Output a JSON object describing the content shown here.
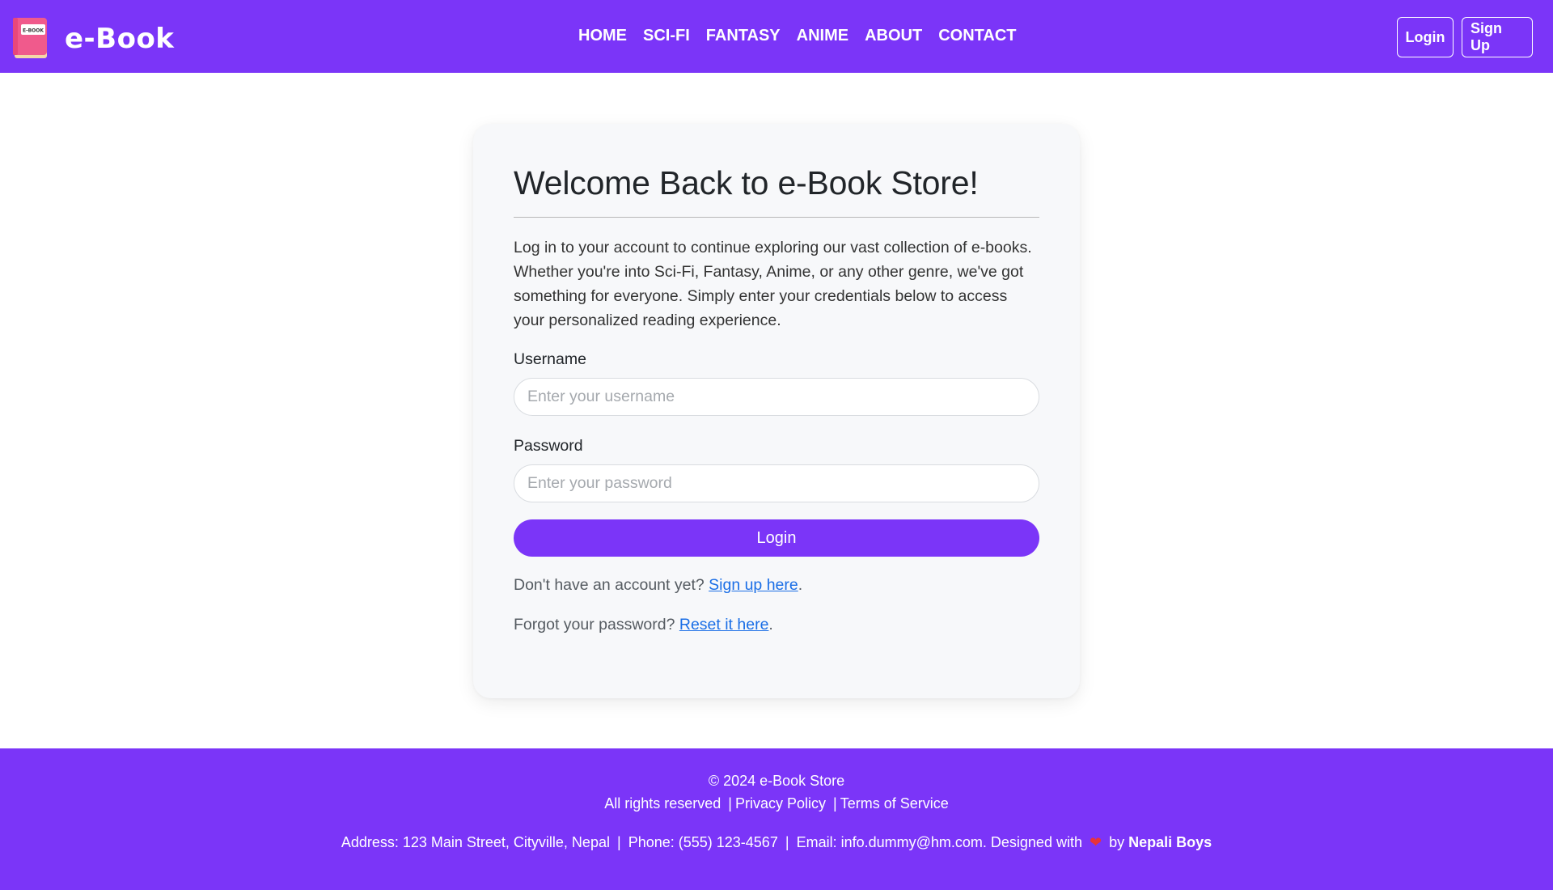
{
  "brand": {
    "name": "e-Book",
    "logo_text": "E-BOOK"
  },
  "nav": {
    "links": [
      "HOME",
      "SCI-FI",
      "FANTASY",
      "ANIME",
      "ABOUT",
      "CONTACT"
    ],
    "login_label": "Login",
    "signup_label": "Sign Up"
  },
  "card": {
    "title": "Welcome Back to e-Book Store!",
    "intro": "Log in to your account to continue exploring our vast collection of e-books. Whether you're into Sci-Fi, Fantasy, Anime, or any other genre, we've got something for everyone. Simply enter your credentials below to access your personalized reading experience.",
    "username_label": "Username",
    "username_placeholder": "Enter your username",
    "password_label": "Password",
    "password_placeholder": "Enter your password",
    "login_button": "Login",
    "signup_prompt": "Don't have an account yet?",
    "signup_link": "Sign up here",
    "reset_prompt": "Forgot your password?",
    "reset_link": "Reset it here",
    "period": "."
  },
  "footer": {
    "copyright": "© 2024 e-Book Store",
    "rights": "All rights reserved",
    "separator": "|",
    "privacy": "Privacy Policy",
    "terms": "Terms of Service",
    "address": "Address: 123 Main Street, Cityville, Nepal",
    "phone": "Phone: (555) 123-4567",
    "email": "Email: info.dummy@hm.com.",
    "designed_with": "Designed with",
    "heart": "❤",
    "by": "by",
    "author": "Nepali Boys"
  },
  "colors": {
    "primary": "#7b35f8",
    "link": "#1a6ee6",
    "heart": "#e8333a"
  }
}
